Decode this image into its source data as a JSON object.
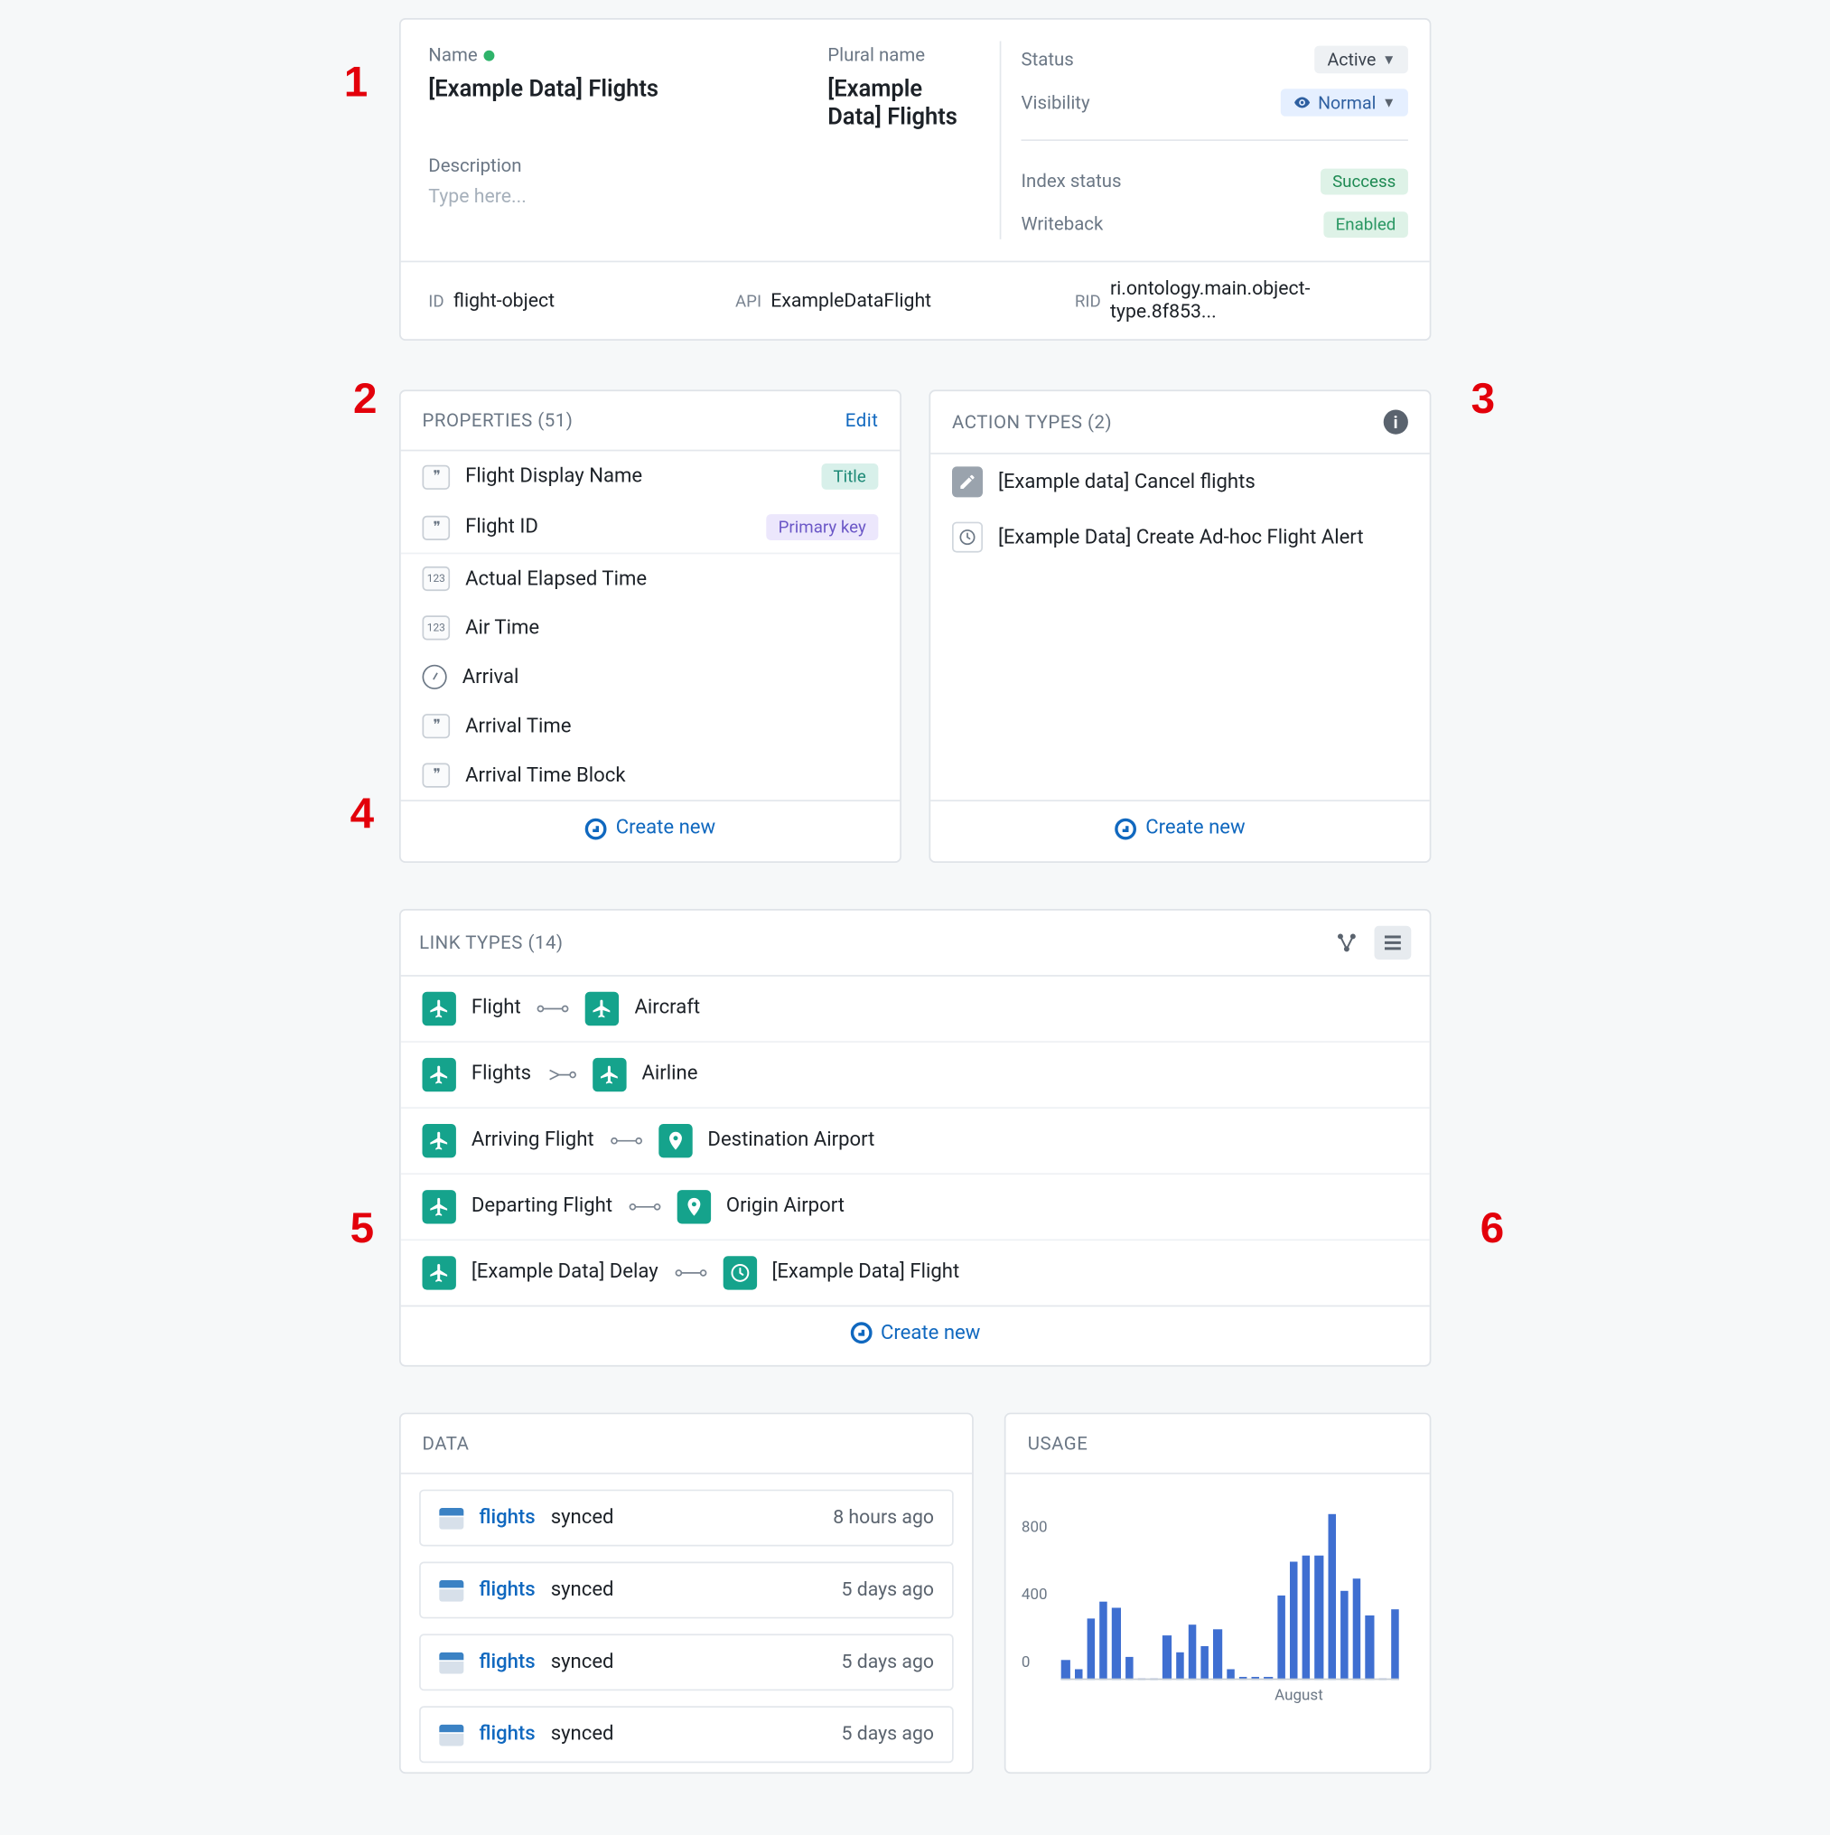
{
  "markers": [
    "1",
    "2",
    "3",
    "4",
    "5",
    "6"
  ],
  "header": {
    "name_label": "Name",
    "name_value": "[Example Data] Flights",
    "plural_label": "Plural name",
    "plural_value": "[Example Data] Flights",
    "desc_label": "Description",
    "desc_placeholder": "Type here...",
    "status_label": "Status",
    "status_value": "Active",
    "visibility_label": "Visibility",
    "visibility_value": "Normal",
    "index_label": "Index status",
    "index_value": "Success",
    "writeback_label": "Writeback",
    "writeback_value": "Enabled",
    "id_label": "ID",
    "id_value": "flight-object",
    "api_label": "API",
    "api_value": "ExampleDataFlight",
    "rid_label": "RID",
    "rid_value": "ri.ontology.main.object-type.8f853..."
  },
  "properties": {
    "title": "PROPERTIES (51)",
    "edit": "Edit",
    "create": "Create new",
    "items": [
      {
        "label": "Flight Display Name",
        "icon": "quote",
        "badge": "Title",
        "badgeClass": "teal"
      },
      {
        "label": "Flight ID",
        "icon": "quote",
        "badge": "Primary key",
        "badgeClass": "lav"
      },
      {
        "label": "Actual Elapsed Time",
        "icon": "num",
        "sep": true
      },
      {
        "label": "Air Time",
        "icon": "num"
      },
      {
        "label": "Arrival",
        "icon": "clock"
      },
      {
        "label": "Arrival Time",
        "icon": "quote"
      },
      {
        "label": "Arrival Time Block",
        "icon": "quote"
      }
    ]
  },
  "actions": {
    "title": "ACTION TYPES (2)",
    "create": "Create new",
    "items": [
      {
        "label": "[Example data] Cancel flights",
        "icon": "pencil"
      },
      {
        "label": "[Example Data] Create Ad-hoc Flight Alert",
        "icon": "clock"
      }
    ]
  },
  "links": {
    "title": "LINK TYPES (14)",
    "create": "Create new",
    "items": [
      {
        "left": "Flight",
        "left_icon": "plane",
        "rel": "one-one",
        "right": "Aircraft",
        "right_icon": "plane"
      },
      {
        "left": "Flights",
        "left_icon": "plane",
        "rel": "many-one",
        "right": "Airline",
        "right_icon": "plane"
      },
      {
        "left": "Arriving Flight",
        "left_icon": "plane",
        "rel": "one-one",
        "right": "Destination Airport",
        "right_icon": "pin"
      },
      {
        "left": "Departing Flight",
        "left_icon": "plane",
        "rel": "one-one",
        "right": "Origin Airport",
        "right_icon": "pin"
      },
      {
        "left": "[Example Data] Delay",
        "left_icon": "plane",
        "rel": "one-one",
        "right": "[Example Data] Flight",
        "right_icon": "clock"
      }
    ]
  },
  "data_panel": {
    "title": "DATA",
    "items": [
      {
        "name": "flights",
        "status": "synced",
        "time": "8 hours ago"
      },
      {
        "name": "flights",
        "status": "synced",
        "time": "5 days ago"
      },
      {
        "name": "flights",
        "status": "synced",
        "time": "5 days ago"
      },
      {
        "name": "flights",
        "status": "synced",
        "time": "5 days ago"
      }
    ]
  },
  "usage": {
    "title": "USAGE",
    "xlabel": "August"
  },
  "chart_data": {
    "type": "bar",
    "title": "",
    "xlabel": "August",
    "ylabel": "",
    "ylim": [
      0,
      1000
    ],
    "yticks": [
      0,
      400,
      800
    ],
    "x": [
      1,
      2,
      3,
      4,
      5,
      6,
      7,
      8,
      9,
      10,
      11,
      12,
      13,
      14,
      15,
      16,
      17,
      18,
      19,
      20,
      21,
      22,
      23,
      24,
      25,
      26,
      27
    ],
    "values": [
      120,
      60,
      360,
      460,
      430,
      140,
      10,
      10,
      260,
      160,
      330,
      200,
      300,
      60,
      20,
      20,
      20,
      500,
      700,
      740,
      740,
      980,
      530,
      600,
      380,
      10,
      420
    ]
  }
}
